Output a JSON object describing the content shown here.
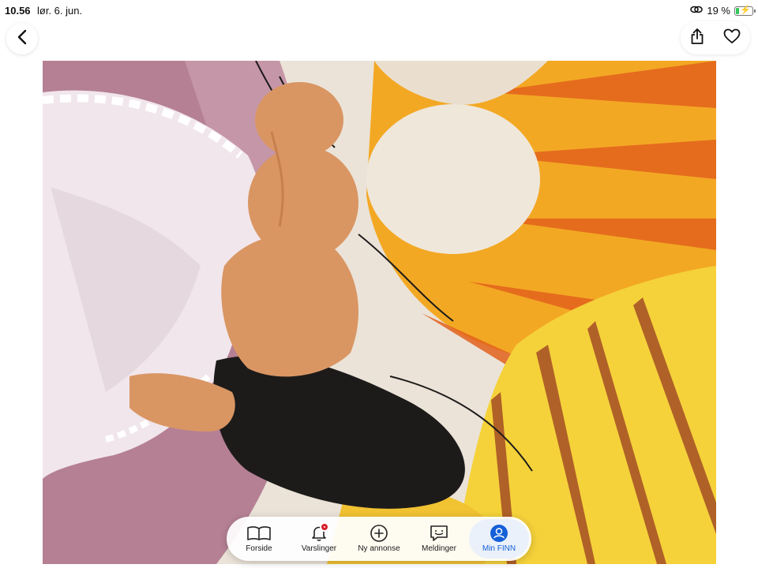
{
  "status": {
    "time": "10.56",
    "date": "lør. 6. jun.",
    "battery": "19 %",
    "battery_level": 0.19,
    "network_icon": "link-icon"
  },
  "toolbar": {
    "back_icon": "chevron-left-icon",
    "share_icon": "share-icon",
    "favorite_icon": "heart-icon"
  },
  "photo": {
    "subject": "listing-photo"
  },
  "nav": {
    "items": [
      {
        "label": "Forside",
        "icon": "book-icon"
      },
      {
        "label": "Varslinger",
        "icon": "bell-icon",
        "badge": true
      },
      {
        "label": "Ny annonse",
        "icon": "plus-circle-icon"
      },
      {
        "label": "Meldinger",
        "icon": "chat-icon"
      },
      {
        "label": "Min FINN",
        "icon": "profile-icon",
        "active": true
      }
    ]
  },
  "colors": {
    "accent": "#1560d8",
    "badge": "#d91e2a",
    "active_bg": "#eaf1fb"
  }
}
